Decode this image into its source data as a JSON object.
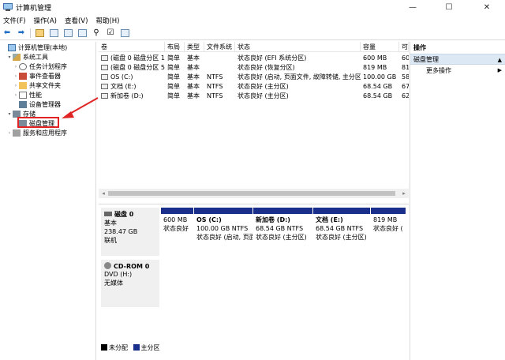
{
  "window": {
    "title": "计算机管理",
    "min": "—",
    "max": "☐",
    "close": "✕"
  },
  "menu": [
    "文件(F)",
    "操作(A)",
    "查看(V)",
    "帮助(H)"
  ],
  "tree": [
    {
      "label": "计算机管理(本地)",
      "icon": "computer-icon",
      "level": 0,
      "exp": ""
    },
    {
      "label": "系统工具",
      "icon": "tools-icon",
      "level": 1,
      "exp": "▾"
    },
    {
      "label": "任务计划程序",
      "icon": "clock-icon",
      "level": 2,
      "exp": "›"
    },
    {
      "label": "事件查看器",
      "icon": "event-icon",
      "level": 2,
      "exp": "›"
    },
    {
      "label": "共享文件夹",
      "icon": "folder-icon",
      "level": 2,
      "exp": "›"
    },
    {
      "label": "性能",
      "icon": "performance-icon",
      "level": 2,
      "exp": "›"
    },
    {
      "label": "设备管理器",
      "icon": "device-icon",
      "level": 2,
      "exp": ""
    },
    {
      "label": "存储",
      "icon": "storage-icon",
      "level": 1,
      "exp": "▾"
    },
    {
      "label": "磁盘管理",
      "icon": "disk-icon",
      "level": 2,
      "exp": ""
    },
    {
      "label": "服务和应用程序",
      "icon": "services-icon",
      "level": 1,
      "exp": "›"
    }
  ],
  "list": {
    "headers": [
      "卷",
      "布局",
      "类型",
      "文件系统",
      "状态",
      "容量",
      "可"
    ],
    "rows": [
      [
        "(磁盘 0 磁盘分区 1)",
        "简单",
        "基本",
        "",
        "状态良好 (EFI 系统分区)",
        "600 MB",
        "60"
      ],
      [
        "(磁盘 0 磁盘分区 5)",
        "简单",
        "基本",
        "",
        "状态良好 (恢复分区)",
        "819 MB",
        "81"
      ],
      [
        "OS (C:)",
        "简单",
        "基本",
        "NTFS",
        "状态良好 (启动, 页面文件, 故障转储, 主分区)",
        "100.00 GB",
        "58"
      ],
      [
        "文档 (E:)",
        "简单",
        "基本",
        "NTFS",
        "状态良好 (主分区)",
        "68.54 GB",
        "67"
      ],
      [
        "新加卷 (D:)",
        "简单",
        "基本",
        "NTFS",
        "状态良好 (主分区)",
        "68.54 GB",
        "62"
      ]
    ]
  },
  "disks": [
    {
      "name": "磁盘 0",
      "type": "基本",
      "size": "238.47 GB",
      "status": "联机"
    },
    {
      "name": "CD-ROM 0",
      "type": "DVD (H:)",
      "size": "",
      "status": "无媒体"
    }
  ],
  "partitions": [
    {
      "name": "",
      "size": "600 MB",
      "status": "状态良好"
    },
    {
      "name": "OS  (C:)",
      "size": "100.00 GB NTFS",
      "status": "状态良好 (启动, 页面"
    },
    {
      "name": "新加卷  (D:)",
      "size": "68.54 GB NTFS",
      "status": "状态良好 (主分区)"
    },
    {
      "name": "文档  (E:)",
      "size": "68.54 GB NTFS",
      "status": "状态良好 (主分区)"
    },
    {
      "name": "",
      "size": "819 MB",
      "status": "状态良好 ("
    }
  ],
  "legend": {
    "unallocated": "未分配",
    "primary": "主分区"
  },
  "actions": {
    "header": "操作",
    "selected": "磁盘管理",
    "more": "更多操作"
  },
  "colors": {
    "unallocated": "#000000",
    "primary": "#1a2f8c",
    "highlight": "#e02424"
  }
}
